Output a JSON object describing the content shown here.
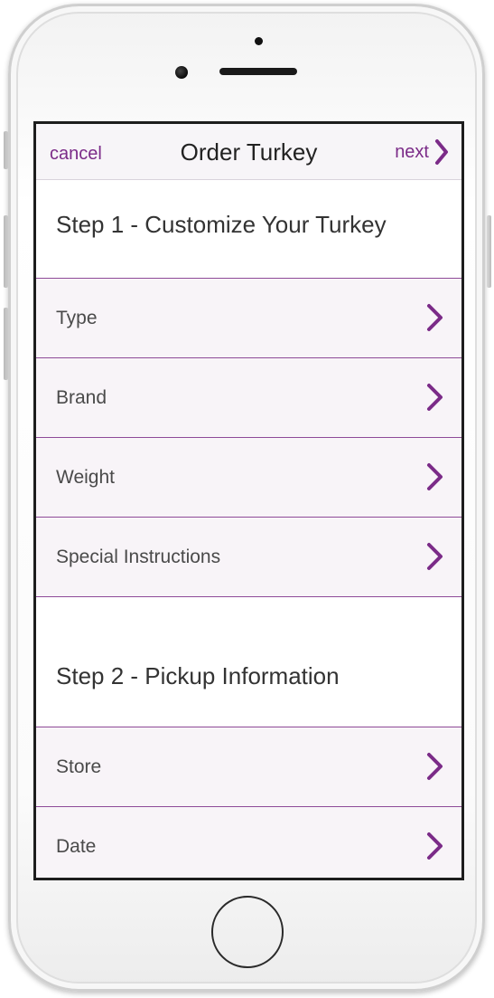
{
  "colors": {
    "accent": "#7b2b88",
    "divider": "#8e4a98",
    "row_bg": "#f8f4f8"
  },
  "navbar": {
    "cancel_label": "cancel",
    "title": "Order Turkey",
    "next_label": "next",
    "next_icon": "chevron-right-icon"
  },
  "step1": {
    "heading": "Step 1 - Customize Your Turkey",
    "items": [
      {
        "label": "Type"
      },
      {
        "label": "Brand"
      },
      {
        "label": "Weight"
      },
      {
        "label": "Special Instructions"
      }
    ]
  },
  "step2": {
    "heading": "Step 2 - Pickup Information",
    "items": [
      {
        "label": "Store"
      },
      {
        "label": "Date"
      }
    ]
  }
}
